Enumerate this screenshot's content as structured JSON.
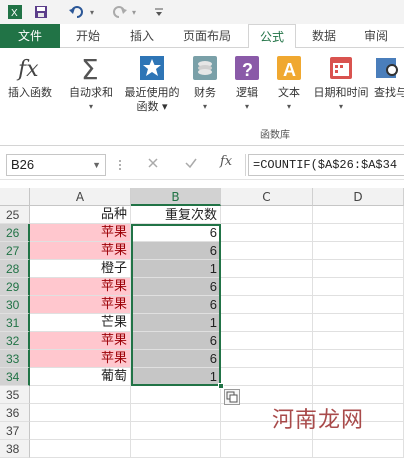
{
  "qat": {
    "icons": [
      "excel-app-icon",
      "save-icon",
      "undo-icon",
      "redo-icon",
      "customize-qat-icon"
    ]
  },
  "tabs": [
    {
      "label": "文件"
    },
    {
      "label": "开始"
    },
    {
      "label": "插入"
    },
    {
      "label": "页面布局"
    },
    {
      "label": "公式",
      "active": true
    },
    {
      "label": "数据"
    },
    {
      "label": "审阅"
    }
  ],
  "ribbon": {
    "group_label": "函数库",
    "buttons": [
      {
        "line1": "插入函数",
        "line2": "",
        "icon": "fx-icon"
      },
      {
        "line1": "自动求和",
        "line2": "▾",
        "icon": "sigma-icon"
      },
      {
        "line1": "最近使用的",
        "line2": "函数 ▾",
        "icon": "star-icon"
      },
      {
        "line1": "财务",
        "line2": "▾",
        "icon": "coins-icon"
      },
      {
        "line1": "逻辑",
        "line2": "▾",
        "icon": "question-icon"
      },
      {
        "line1": "文本",
        "line2": "▾",
        "icon": "text-a-icon"
      },
      {
        "line1": "日期和时间",
        "line2": "▾",
        "icon": "calendar-icon"
      },
      {
        "line1": "查找与",
        "line2": "",
        "icon": "lookup-icon"
      }
    ]
  },
  "formula_bar": {
    "name_box": "B26",
    "fx": "fx",
    "formula": "=COUNTIF($A$26:$A$34"
  },
  "columns": [
    "A",
    "B",
    "C",
    "D"
  ],
  "rows": [
    {
      "num": "25",
      "a": "品种",
      "b": "重复次数",
      "a_style": "white",
      "b_style": "white"
    },
    {
      "num": "26",
      "a": "苹果",
      "b": "6",
      "a_style": "pink",
      "b_style": "white"
    },
    {
      "num": "27",
      "a": "苹果",
      "b": "6",
      "a_style": "pink",
      "b_style": "gray"
    },
    {
      "num": "28",
      "a": "橙子",
      "b": "1",
      "a_style": "white",
      "b_style": "gray"
    },
    {
      "num": "29",
      "a": "苹果",
      "b": "6",
      "a_style": "pink",
      "b_style": "gray"
    },
    {
      "num": "30",
      "a": "苹果",
      "b": "6",
      "a_style": "pink",
      "b_style": "gray"
    },
    {
      "num": "31",
      "a": "芒果",
      "b": "1",
      "a_style": "white",
      "b_style": "gray"
    },
    {
      "num": "32",
      "a": "苹果",
      "b": "6",
      "a_style": "pink",
      "b_style": "gray"
    },
    {
      "num": "33",
      "a": "苹果",
      "b": "6",
      "a_style": "pink",
      "b_style": "gray"
    },
    {
      "num": "34",
      "a": "葡萄",
      "b": "1",
      "a_style": "white",
      "b_style": "gray"
    },
    {
      "num": "35",
      "a": "",
      "b": "",
      "a_style": "white",
      "b_style": "white"
    },
    {
      "num": "36",
      "a": "",
      "b": "",
      "a_style": "white",
      "b_style": "white"
    },
    {
      "num": "37",
      "a": "",
      "b": "",
      "a_style": "white",
      "b_style": "white"
    },
    {
      "num": "38",
      "a": "",
      "b": "",
      "a_style": "white",
      "b_style": "white"
    }
  ],
  "watermark": "河南龙网",
  "colors": {
    "excel_green": "#217346",
    "duplicate_fill": "#ffc7ce",
    "duplicate_text": "#9c0006",
    "selection_fill": "#c6c6c6"
  }
}
